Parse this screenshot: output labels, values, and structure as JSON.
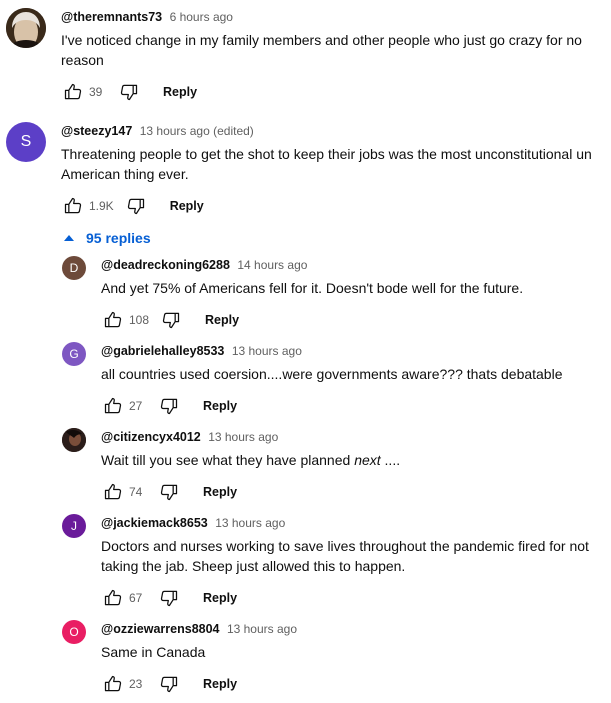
{
  "comments": [
    {
      "author": "@theremnants73",
      "time": "6 hours ago",
      "text": "I've noticed change in my family members and other people who just go crazy for no reason",
      "likes": "39",
      "reply_label": "Reply",
      "avatar_color": "#3a2a1a"
    },
    {
      "author": "@steezy147",
      "time": "13 hours ago (edited)",
      "text": "Threatening people to get the shot to keep their jobs was the most unconstitutional un American thing ever.",
      "likes": "1.9K",
      "reply_label": "Reply",
      "avatar_letter": "S",
      "avatar_color": "#5c3fc7"
    }
  ],
  "replies_toggle": {
    "label": "95 replies",
    "color": "#065fd4"
  },
  "replies": [
    {
      "author": "@deadreckoning6288",
      "time": "14 hours ago",
      "text": "And yet 75% of Americans fell for it. Doesn't bode well for the future.",
      "likes": "108",
      "reply_label": "Reply",
      "avatar_letter": "D",
      "avatar_color": "#6d4a3a"
    },
    {
      "author": "@gabrielehalley8533",
      "time": "13 hours ago",
      "text": "all countries used coersion....were governments aware??? thats debatable",
      "likes": "27",
      "reply_label": "Reply",
      "avatar_letter": "G",
      "avatar_color": "#7e57c2"
    },
    {
      "author": "@citizencyx4012",
      "time": "13 hours ago",
      "text_main": "Wait till you see what they have planned ",
      "text_italic": "next",
      "text_tail": " ....",
      "likes": "74",
      "reply_label": "Reply",
      "avatar_color": "#2b1d1a"
    },
    {
      "author": "@jackiemack8653",
      "time": "13 hours ago",
      "text": "Doctors and nurses working to save lives throughout the pandemic fired for not taking the jab. Sheep just allowed this to happen.",
      "likes": "67",
      "reply_label": "Reply",
      "avatar_letter": "J",
      "avatar_color": "#6a1b9a"
    },
    {
      "author": "@ozziewarrens8804",
      "time": "13 hours ago",
      "text": "Same in Canada",
      "likes": "23",
      "reply_label": "Reply",
      "avatar_letter": "O",
      "avatar_color": "#e91e63"
    }
  ],
  "icons": {
    "like": "thumbs-up-icon",
    "dislike": "thumbs-down-icon",
    "expand": "caret-up-icon"
  }
}
